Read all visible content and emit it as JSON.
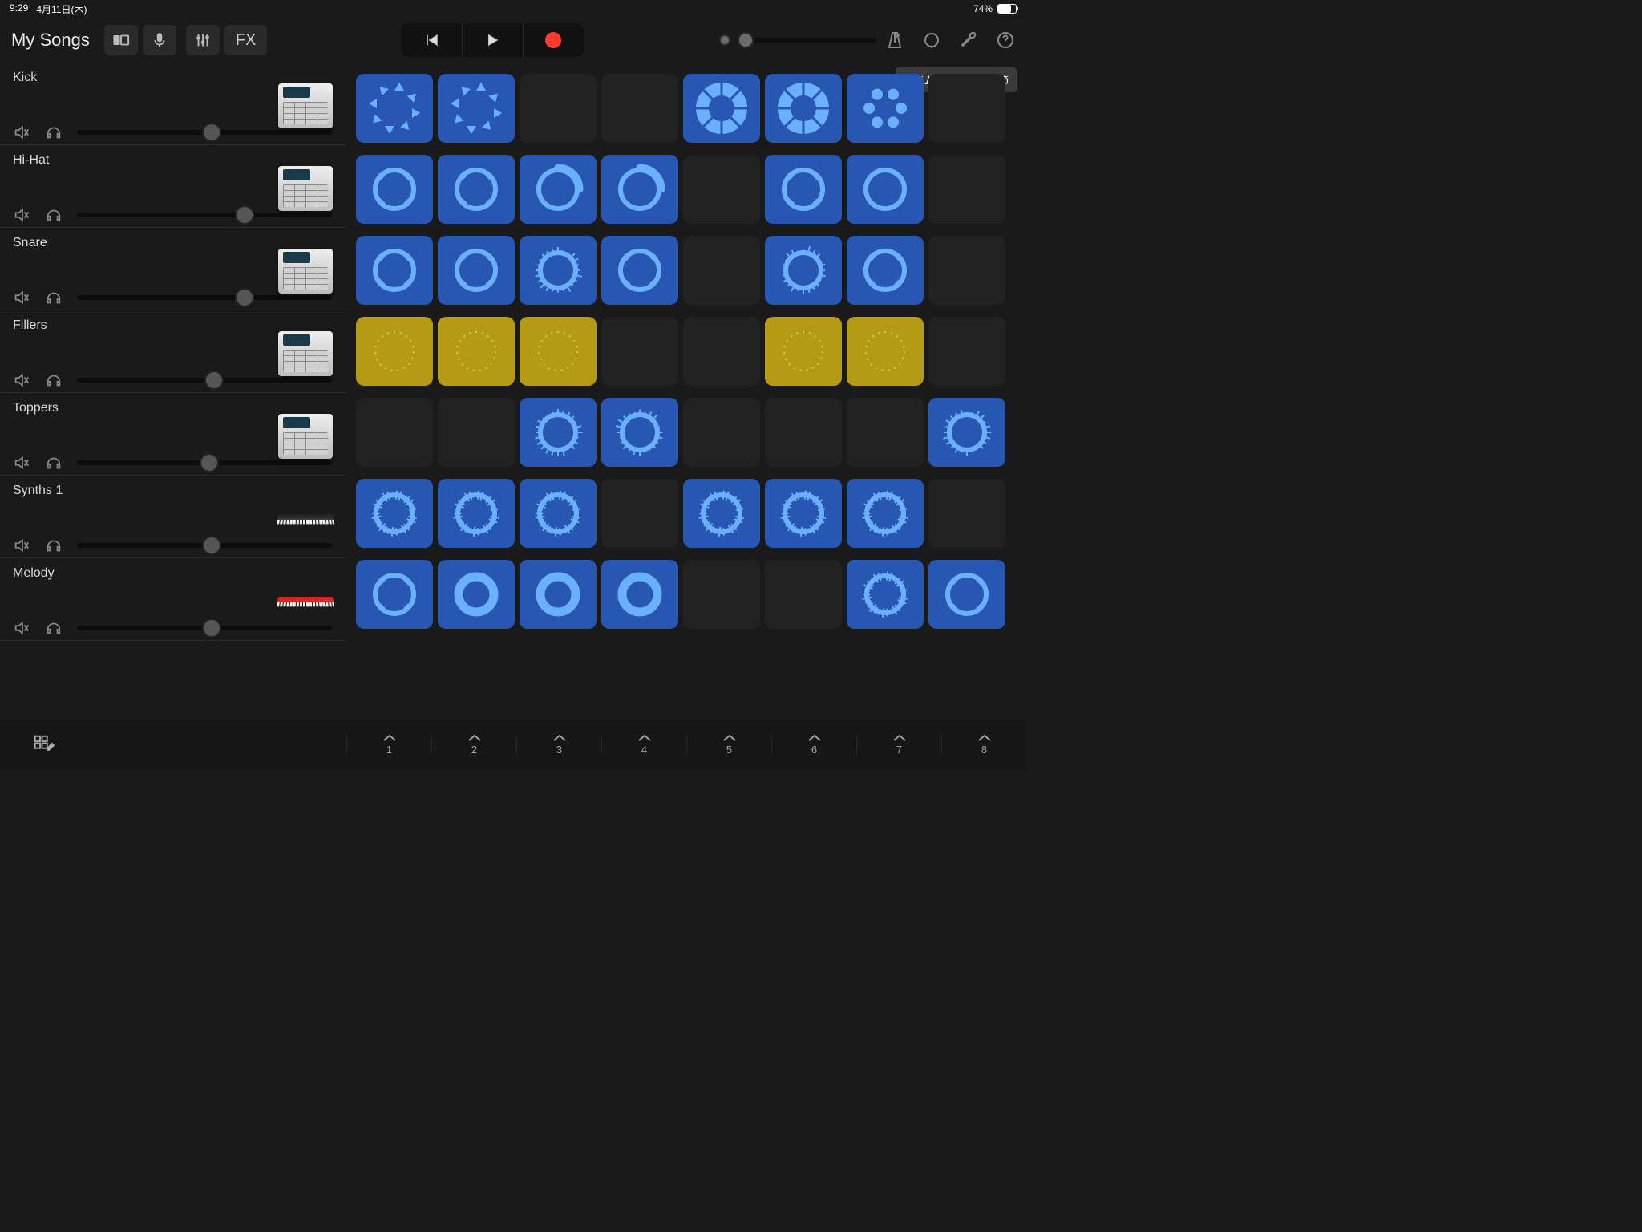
{
  "status": {
    "time": "9:29",
    "date": "4月11日(木)",
    "battery_pct": "74%"
  },
  "header": {
    "my_songs": "My Songs",
    "fx": "FX"
  },
  "snap_label": "タイムスナップ: 1小節",
  "tracks": [
    {
      "name": "Kick",
      "instrument": "mpc",
      "vol": 49
    },
    {
      "name": "Hi-Hat",
      "instrument": "mpc",
      "vol": 62
    },
    {
      "name": "Snare",
      "instrument": "mpc",
      "vol": 62
    },
    {
      "name": "Fillers",
      "instrument": "mpc",
      "vol": 50
    },
    {
      "name": "Toppers",
      "instrument": "mpc",
      "vol": 48
    },
    {
      "name": "Synths 1",
      "instrument": "keys",
      "vol": 49
    },
    {
      "name": "Melody",
      "instrument": "keys-red",
      "vol": 49
    }
  ],
  "grid": [
    [
      {
        "c": "blue",
        "p": "burst"
      },
      {
        "c": "blue",
        "p": "burst"
      },
      null,
      null,
      {
        "c": "blue",
        "p": "donut"
      },
      {
        "c": "blue",
        "p": "donut"
      },
      {
        "c": "blue",
        "p": "burst2"
      },
      null
    ],
    [
      {
        "c": "blue",
        "p": "ring"
      },
      {
        "c": "blue",
        "p": "ring"
      },
      {
        "c": "blue",
        "p": "ring2"
      },
      {
        "c": "blue",
        "p": "ring2"
      },
      null,
      {
        "c": "blue",
        "p": "ring"
      },
      {
        "c": "blue",
        "p": "ringdots"
      },
      null
    ],
    [
      {
        "c": "blue",
        "p": "ring"
      },
      {
        "c": "blue",
        "p": "ring"
      },
      {
        "c": "blue",
        "p": "spiky"
      },
      {
        "c": "blue",
        "p": "ring"
      },
      null,
      {
        "c": "blue",
        "p": "spiky"
      },
      {
        "c": "blue",
        "p": "ring"
      },
      null
    ],
    [
      {
        "c": "yellow",
        "p": "dots"
      },
      {
        "c": "yellow",
        "p": "dots"
      },
      {
        "c": "yellow",
        "p": "dots"
      },
      null,
      null,
      {
        "c": "yellow",
        "p": "dots"
      },
      {
        "c": "yellow",
        "p": "dots"
      },
      null
    ],
    [
      null,
      null,
      {
        "c": "blue",
        "p": "spiky"
      },
      {
        "c": "blue",
        "p": "spiky"
      },
      null,
      null,
      null,
      {
        "c": "blue",
        "p": "spiky"
      }
    ],
    [
      {
        "c": "blue",
        "p": "wavy"
      },
      {
        "c": "blue",
        "p": "wavy"
      },
      {
        "c": "blue",
        "p": "wavy"
      },
      null,
      {
        "c": "blue",
        "p": "wavy"
      },
      {
        "c": "blue",
        "p": "wavy"
      },
      {
        "c": "blue",
        "p": "wavy"
      },
      null
    ],
    [
      {
        "c": "blue",
        "p": "ring"
      },
      {
        "c": "blue",
        "p": "thick"
      },
      {
        "c": "blue",
        "p": "thick"
      },
      {
        "c": "blue",
        "p": "thick"
      },
      null,
      null,
      {
        "c": "blue",
        "p": "wavy"
      },
      {
        "c": "blue",
        "p": "ring"
      }
    ]
  ],
  "columns": [
    "1",
    "2",
    "3",
    "4",
    "5",
    "6",
    "7",
    "8"
  ]
}
